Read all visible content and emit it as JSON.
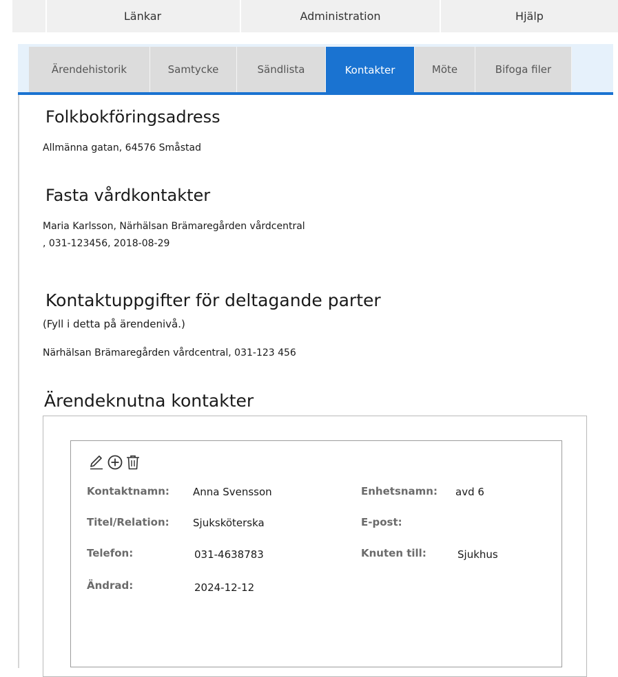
{
  "menu": {
    "items": [
      "Länkar",
      "Administration",
      "Hjälp"
    ]
  },
  "tabs": [
    {
      "label": "Ärendehistorik",
      "active": false
    },
    {
      "label": "Samtycke",
      "active": false
    },
    {
      "label": "Sändlista",
      "active": false
    },
    {
      "label": "Kontakter",
      "active": true
    },
    {
      "label": "Möte",
      "active": false
    },
    {
      "label": "Bifoga filer",
      "active": false
    }
  ],
  "sections": {
    "folkbokforing": {
      "title": "Folkbokföringsadress",
      "address": "Allmänna gatan, 64576 Småstad"
    },
    "fasta": {
      "title": "Fasta vårdkontakter",
      "line1": "Maria Karlsson, Närhälsan Brämaregården vårdcentral",
      "line2": ", 031-123456, 2018-08-29"
    },
    "parter": {
      "title": "Kontaktuppgifter för deltagande parter",
      "note": "(Fyll i detta på ärendenivå.)",
      "line": "Närhälsan Brämaregården vårdcentral, 031-123 456"
    },
    "arende": {
      "title": "Ärendeknutna kontakter"
    }
  },
  "contact": {
    "fields": {
      "kontaktnamn": {
        "label": "Kontaktnamn:",
        "value": "Anna Svensson"
      },
      "titel": {
        "label": "Titel/Relation:",
        "value": "Sjuksköterska"
      },
      "telefon": {
        "label": "Telefon:",
        "value": "031-4638783"
      },
      "andrad": {
        "label": "Ändrad:",
        "value": "2024-12-12"
      },
      "enhetsnamn": {
        "label": "Enhetsnamn:",
        "value": "avd 6"
      },
      "epost": {
        "label": "E-post:",
        "value": ""
      },
      "knuten": {
        "label": "Knuten till:",
        "value": "Sjukhus"
      }
    },
    "icons": [
      "edit-icon",
      "add-icon",
      "delete-icon"
    ]
  },
  "colors": {
    "accent": "#1a73d1",
    "tab_bg": "#dcdcdc",
    "tab_area": "#e6f1fb",
    "label": "#6b6b6b"
  }
}
